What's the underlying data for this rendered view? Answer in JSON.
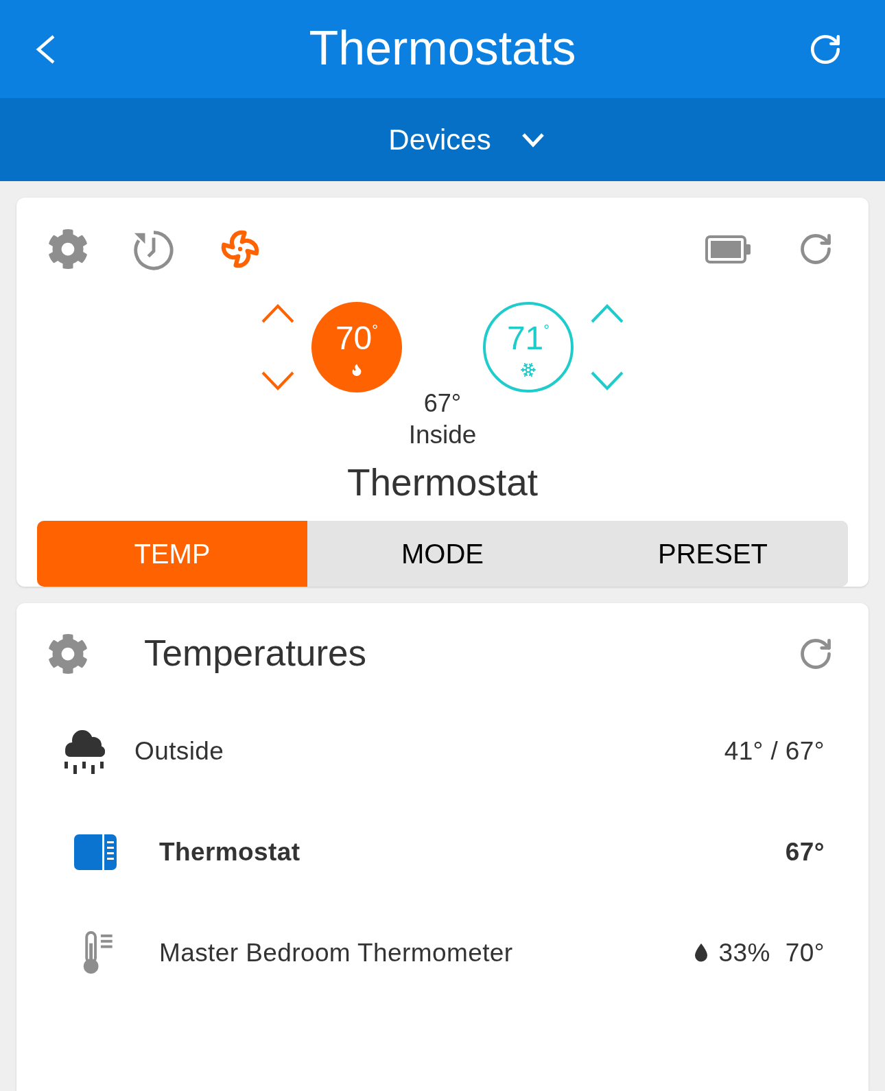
{
  "header": {
    "title": "Thermostats"
  },
  "devices_menu": {
    "label": "Devices",
    "expanded": false
  },
  "thermostat_card": {
    "fan": {
      "on": true
    },
    "setpoints": [
      {
        "kind": "heat",
        "value": "70$^{°}$"
      },
      {
        "kind": "cool",
        "value": "71$^{°}$"
      }
    ],
    "inside": {
      "reading": "67°",
      "label": "Inside"
    },
    "name": "Thermostat",
    "tabs": [
      {
        "label": "TEMP",
        "selected": true
      },
      {
        "label": "MODE",
        "selected": false
      },
      {
        "label": "PRESET",
        "selected": false
      }
    ]
  },
  "temperatures_card": {
    "title": "Temperatures",
    "rows": [
      {
        "kind": "weather",
        "name": "Outside",
        "reading": "41° / 67°",
        "highlighted": false
      },
      {
        "kind": "thermostat",
        "name": "Thermostat",
        "reading": "67°",
        "highlighted": true
      },
      {
        "kind": "thermometer",
        "name": "Master Bedroom Thermometer",
        "humidity": "33%",
        "reading": "70°",
        "highlighted": false
      }
    ]
  }
}
